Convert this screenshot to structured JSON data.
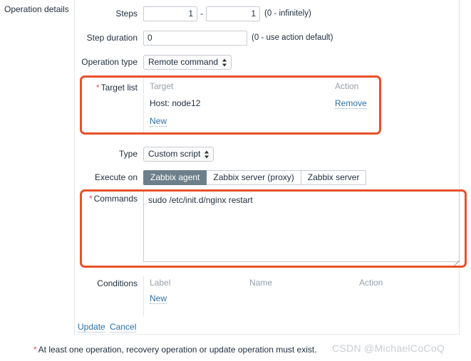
{
  "section": {
    "label": "Operation details"
  },
  "fields": {
    "steps": {
      "label": "Steps",
      "from_value": "1",
      "separator": "-",
      "to_value": "1",
      "hint": "(0 - infinitely)"
    },
    "step_duration": {
      "label": "Step duration",
      "value": "0",
      "hint": "(0 - use action default)"
    },
    "operation_type": {
      "label": "Operation type",
      "value": "Remote command",
      "icon": "updown-arrows-icon"
    },
    "target_list": {
      "label": "Target list",
      "required_marker": "*",
      "headers": {
        "target": "Target",
        "action": "Action"
      },
      "rows": [
        {
          "target": "Host: node12",
          "action": "Remove"
        }
      ],
      "new_link": "New"
    },
    "type": {
      "label": "Type",
      "value": "Custom script",
      "icon": "updown-arrows-icon"
    },
    "execute_on": {
      "label": "Execute on",
      "options": [
        "Zabbix agent",
        "Zabbix server (proxy)",
        "Zabbix server"
      ],
      "selected": "Zabbix agent"
    },
    "commands": {
      "label": "Commands",
      "required_marker": "*",
      "value": "sudo /etc/init.d/nginx restart",
      "placeholder": ""
    },
    "conditions": {
      "label": "Conditions",
      "headers": {
        "label": "Label",
        "name": "Name",
        "action": "Action"
      },
      "rows": [],
      "new_link": "New"
    }
  },
  "actions": {
    "update": "Update",
    "cancel": "Cancel"
  },
  "footer": {
    "required_marker": "*",
    "note": "At least one operation, recovery operation or update operation must exist.",
    "watermark": "CSDN @MichaelCoCoQ"
  },
  "colors": {
    "annotation": "#e8502a",
    "link": "#2c71a8",
    "selected_segment": "#6d7f8b",
    "required": "#d64e4e",
    "muted_header": "#97a1ab"
  }
}
